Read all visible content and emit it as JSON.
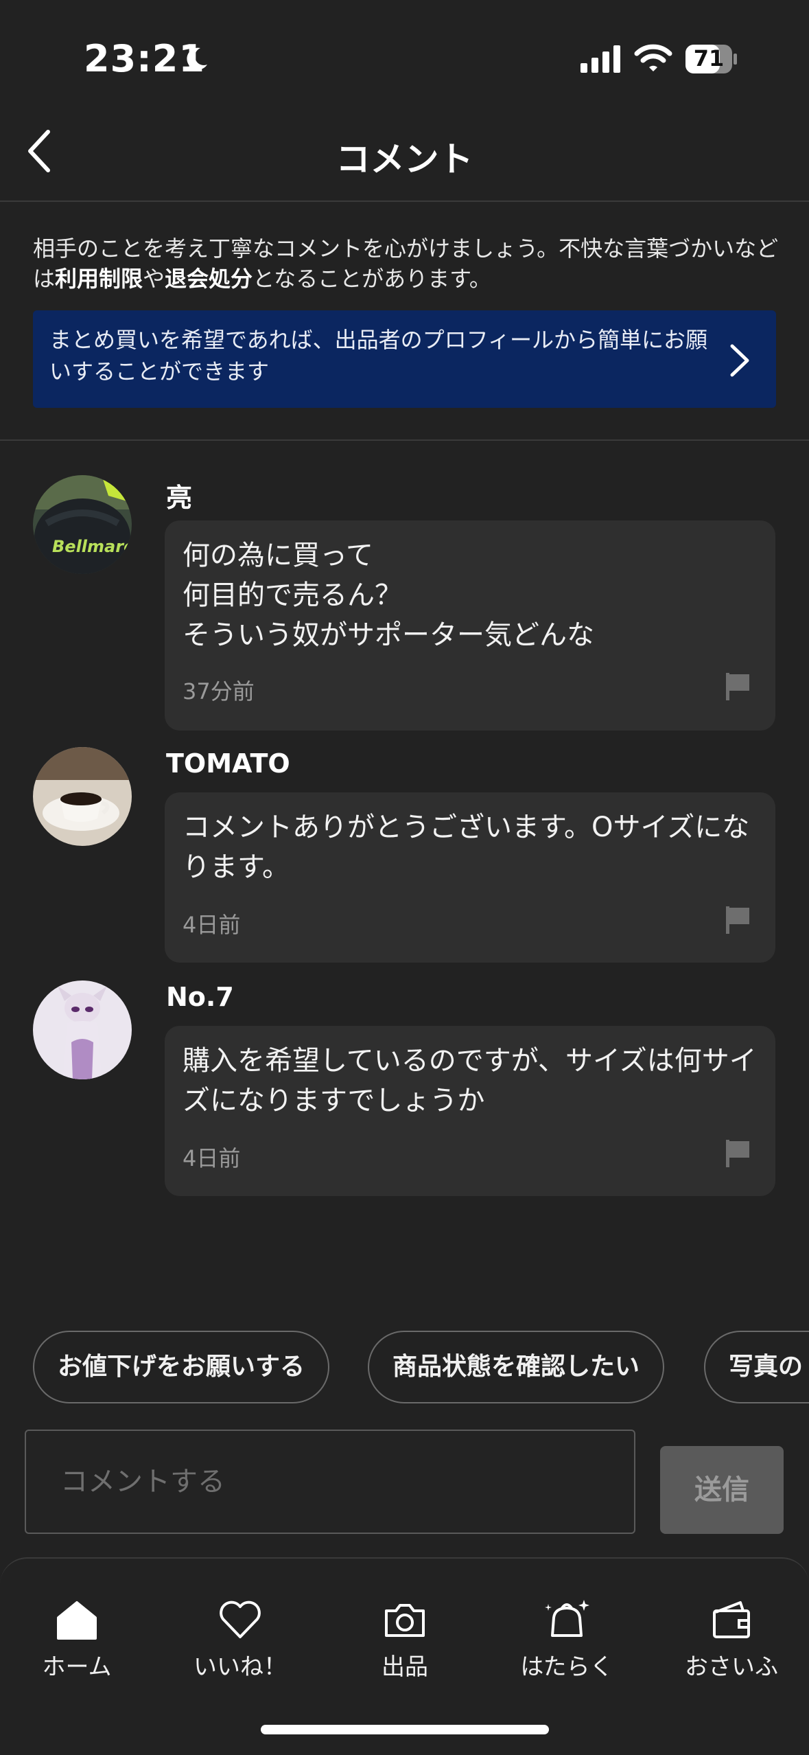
{
  "status_bar": {
    "time": "23:21",
    "battery": "71"
  },
  "header": {
    "title": "コメント"
  },
  "notice": {
    "part1": "相手のことを考え丁寧なコメントを心がけましょう。不快な言葉づかいなどは",
    "bold1": "利用制限",
    "part2": "や",
    "bold2": "退会処分",
    "part3": "となることがあります。"
  },
  "banner": {
    "text": "まとめ買いを希望であれば、出品者のプロフィールから簡単にお願いすることができます"
  },
  "comments": [
    {
      "user": "亮",
      "text": "何の為に買って\n何目的で売るん？\nそういう奴がサポーター気どんな",
      "time": "37分前"
    },
    {
      "user": "TOMATO",
      "text": "コメントありがとうございます。Oサイズになります。",
      "time": "4日前"
    },
    {
      "user": "No.7",
      "text": "購入を希望しているのですが、サイズは何サイズになりますでしょうか",
      "time": "4日前"
    }
  ],
  "chips": [
    "お値下げをお願いする",
    "商品状態を確認したい",
    "写真の"
  ],
  "input": {
    "placeholder": "コメントする"
  },
  "send_label": "送信",
  "tabs": [
    {
      "label": "ホーム",
      "icon": "home-icon"
    },
    {
      "label": "いいね！",
      "icon": "heart-icon"
    },
    {
      "label": "出品",
      "icon": "camera-icon"
    },
    {
      "label": "はたらく",
      "icon": "sparkle-bag-icon"
    },
    {
      "label": "おさいふ",
      "icon": "wallet-icon"
    }
  ],
  "colors": {
    "background": "#222222",
    "banner": "#0b2660",
    "bubble": "#2f2f2f",
    "send_disabled": "#5a5a5a"
  }
}
